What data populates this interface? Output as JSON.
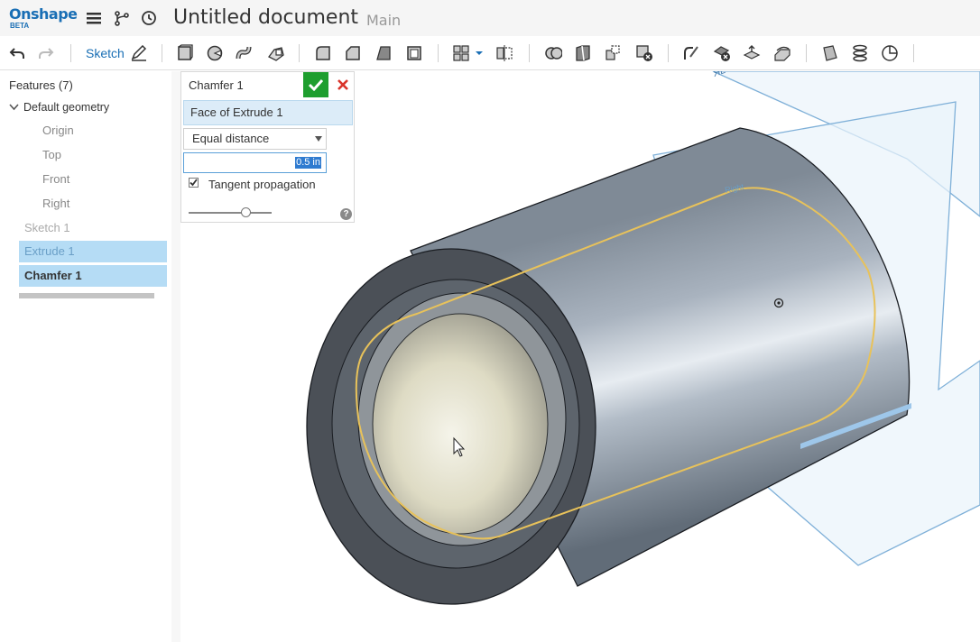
{
  "app": {
    "logo_text": "Onshape",
    "logo_badge": "BETA",
    "document_title": "Untitled document",
    "branch": "Main"
  },
  "topbar_icons": [
    "menu-icon",
    "versions-branch-icon",
    "history-icon"
  ],
  "toolbar": {
    "undo_icon": "undo-icon",
    "redo_icon": "redo-icon",
    "sketch_label": "Sketch",
    "tools": [
      "extrude",
      "revolve",
      "sweep",
      "loft",
      "fillet",
      "chamfer",
      "draft",
      "shell",
      "pattern",
      "mirror",
      "boolean",
      "split",
      "transform",
      "delete-part",
      "modify-fillet",
      "delete-face",
      "move-face",
      "replace-face",
      "plane",
      "helix",
      "mate-connector"
    ]
  },
  "feature_tree": {
    "title": "Features (7)",
    "default_geometry": "Default geometry",
    "planes": [
      "Origin",
      "Top",
      "Front",
      "Right"
    ],
    "sketch": "Sketch 1",
    "extrude": "Extrude 1",
    "chamfer": "Chamfer 1"
  },
  "dialog": {
    "title": "Chamfer 1",
    "selection": "Face of Extrude 1",
    "type_option": "Equal distance",
    "distance_value": "0.5 in",
    "tangent_label": "Tangent propagation",
    "tangent_checked": true,
    "help": "?",
    "colors": {
      "ok": "#1e9e2e",
      "cancel": "#d9342b"
    }
  },
  "viewport": {
    "plane_label": "Right",
    "top_fragment": "ЯL"
  },
  "colors": {
    "accent": "#1a6fb5",
    "selection_fill": "#b5dcf5",
    "highlight_edge": "#e8c25a"
  }
}
